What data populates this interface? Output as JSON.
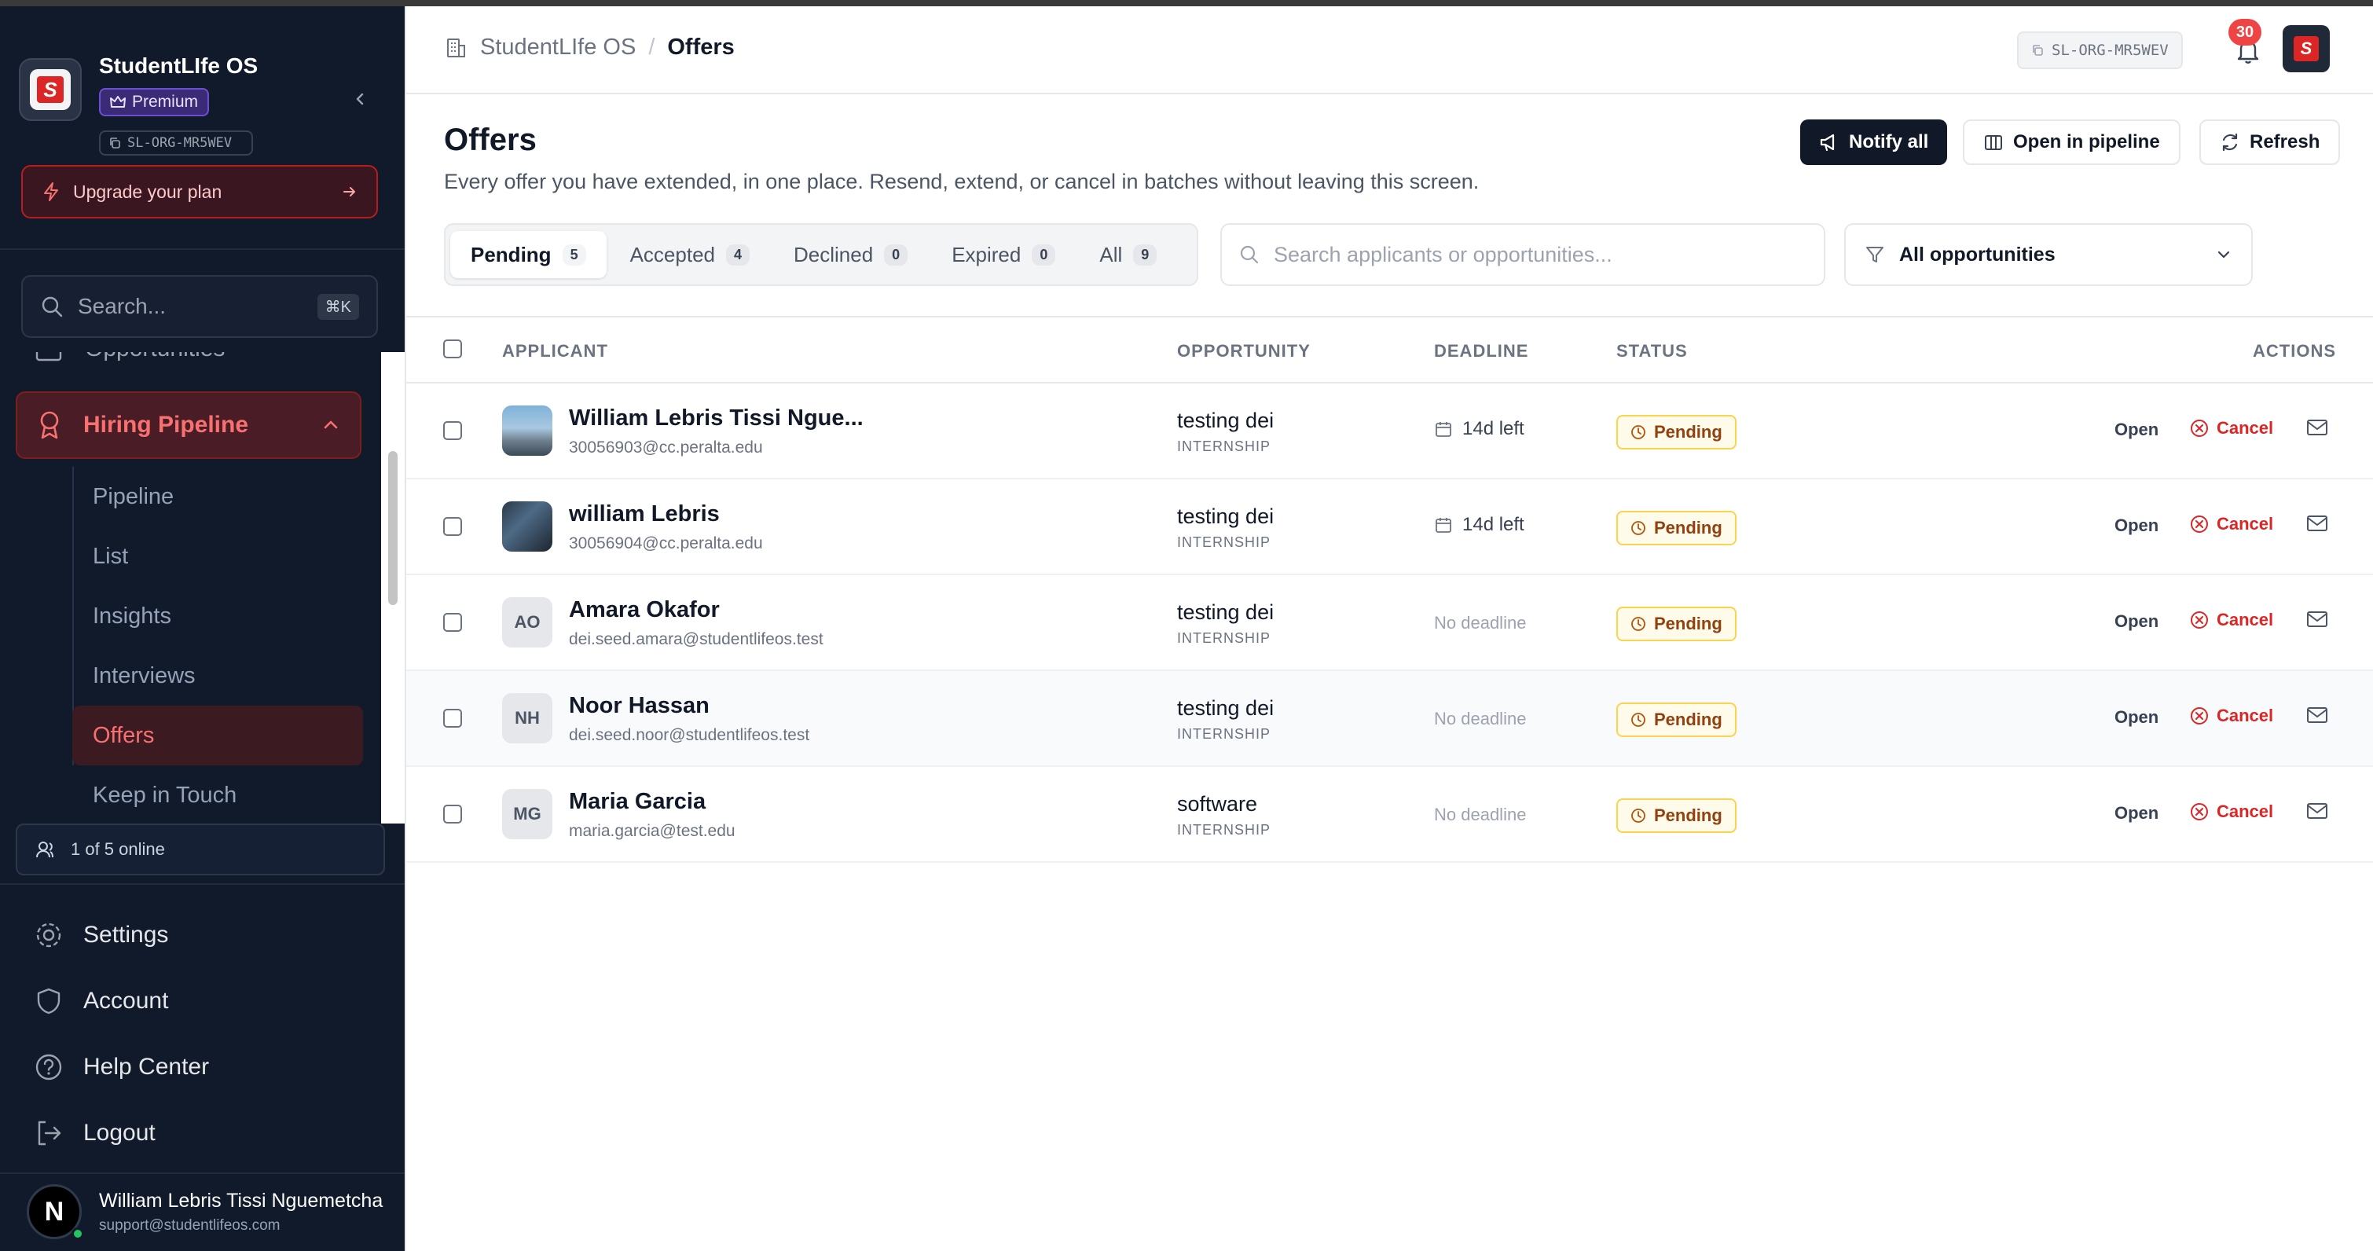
{
  "brand": {
    "name": "StudentLIfe OS",
    "plan": "Premium",
    "org_id": "SL-ORG-MR5WEV",
    "logo_letter": "S"
  },
  "sidebar": {
    "upgrade_label": "Upgrade your plan",
    "search_placeholder": "Search...",
    "search_shortcut": "⌘K",
    "partial_item": "Opportunities",
    "section": "Hiring Pipeline",
    "sub_items": [
      "Pipeline",
      "List",
      "Insights",
      "Interviews",
      "Offers",
      "Keep in Touch"
    ],
    "active_sub": "Offers",
    "online": "1 of 5 online",
    "bottom_items": [
      "Settings",
      "Account",
      "Help Center",
      "Logout"
    ],
    "user": {
      "initial": "N",
      "name": "William Lebris Tissi Nguemetcha",
      "email": "support@studentlifeos.com"
    }
  },
  "header": {
    "breadcrumb": [
      "StudentLIfe OS",
      "Offers"
    ],
    "breadcrumb_sep": "/",
    "org_id": "SL-ORG-MR5WEV",
    "notifications": "30"
  },
  "page": {
    "title": "Offers",
    "subtitle": "Every offer you have extended, in one place. Resend, extend, or cancel in batches without leaving this screen.",
    "buttons": {
      "notify": "Notify all",
      "pipeline": "Open in pipeline",
      "refresh": "Refresh"
    }
  },
  "tabs": [
    {
      "label": "Pending",
      "count": "5"
    },
    {
      "label": "Accepted",
      "count": "4"
    },
    {
      "label": "Declined",
      "count": "0"
    },
    {
      "label": "Expired",
      "count": "0"
    },
    {
      "label": "All",
      "count": "9"
    }
  ],
  "search_placeholder": "Search applicants or opportunities...",
  "filter_label": "All opportunities",
  "table": {
    "columns": {
      "applicant": "APPLICANT",
      "opportunity": "OPPORTUNITY",
      "deadline": "DEADLINE",
      "status": "STATUS",
      "actions": "ACTIONS"
    },
    "rows": [
      {
        "initials": "",
        "name": "William Lebris Tissi Ngue...",
        "email": "30056903@cc.peralta.edu",
        "opportunity": "testing dei",
        "type": "INTERNSHIP",
        "deadline": "14d left",
        "status": "Pending",
        "open": "Open",
        "cancel": "Cancel"
      },
      {
        "initials": "",
        "name": "william Lebris",
        "email": "30056904@cc.peralta.edu",
        "opportunity": "testing dei",
        "type": "INTERNSHIP",
        "deadline": "14d left",
        "status": "Pending",
        "open": "Open",
        "cancel": "Cancel"
      },
      {
        "initials": "AO",
        "name": "Amara Okafor",
        "email": "dei.seed.amara@studentlifeos.test",
        "opportunity": "testing dei",
        "type": "INTERNSHIP",
        "deadline": "No deadline",
        "status": "Pending",
        "open": "Open",
        "cancel": "Cancel"
      },
      {
        "initials": "NH",
        "name": "Noor Hassan",
        "email": "dei.seed.noor@studentlifeos.test",
        "opportunity": "testing dei",
        "type": "INTERNSHIP",
        "deadline": "No deadline",
        "status": "Pending",
        "open": "Open",
        "cancel": "Cancel"
      },
      {
        "initials": "MG",
        "name": "Maria Garcia",
        "email": "maria.garcia@test.edu",
        "opportunity": "software",
        "type": "INTERNSHIP",
        "deadline": "No deadline",
        "status": "Pending",
        "open": "Open",
        "cancel": "Cancel"
      }
    ]
  },
  "colors": {
    "sidebar_bg": "#111a2b",
    "accent_red": "#dc2626",
    "pending_bg": "#fffbeb",
    "pending_border": "#fcd34d"
  }
}
